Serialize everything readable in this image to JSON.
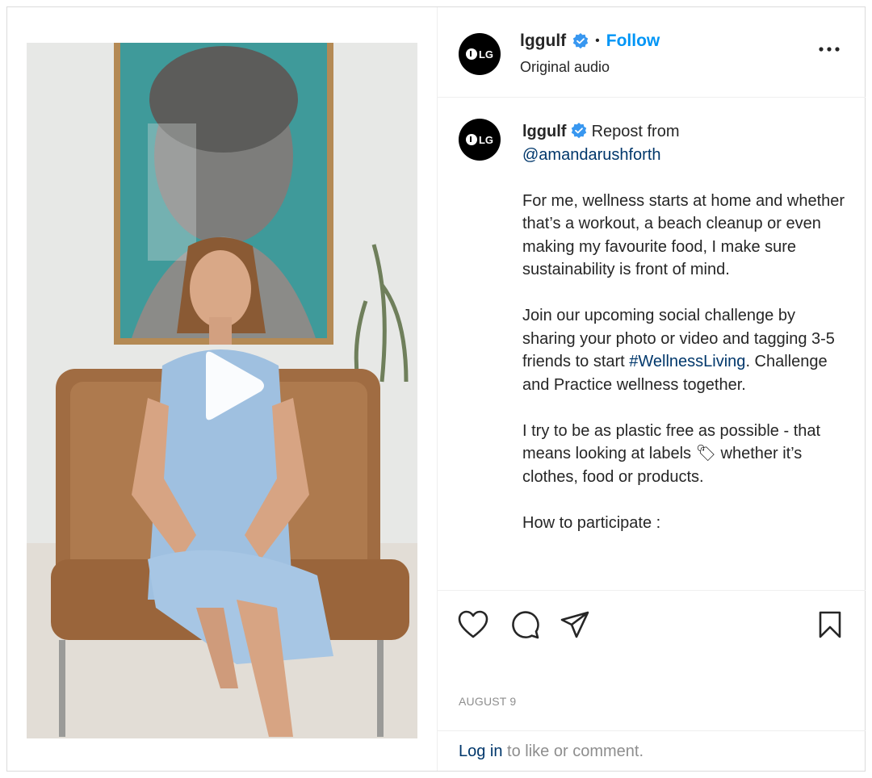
{
  "header": {
    "username": "lggulf",
    "separator": "•",
    "follow_label": "Follow",
    "audio_label": "Original audio",
    "avatar_text": "LG"
  },
  "caption": {
    "username": "lggulf",
    "repost_prefix": "Repost from",
    "mention": "@amandarushforth",
    "para1": "For me, wellness starts at home and whether that’s a workout, a beach cleanup or even making my favourite food, I make sure sustainability is front of mind.",
    "para2_before": "Join our upcoming social challenge by sharing your photo or video and tagging 3-5 friends to start",
    "hashtag": "#WellnessLiving",
    "para2_after": ". Challenge and Practice wellness together.",
    "para3": "I try to be as plastic free as possible - that means looking at labels 🏷 whether it’s clothes, food or products.",
    "para4": "How to participate :"
  },
  "footer": {
    "date": "AUGUST 9",
    "login_link": "Log in",
    "login_rest": " to like or comment."
  },
  "colors": {
    "follow": "#0095f6",
    "link": "#00376b",
    "verified": "#3897f0"
  },
  "icons": [
    "verified-badge-icon",
    "more-options-icon",
    "play-icon",
    "heart-icon",
    "comment-icon",
    "share-icon",
    "bookmark-icon"
  ]
}
